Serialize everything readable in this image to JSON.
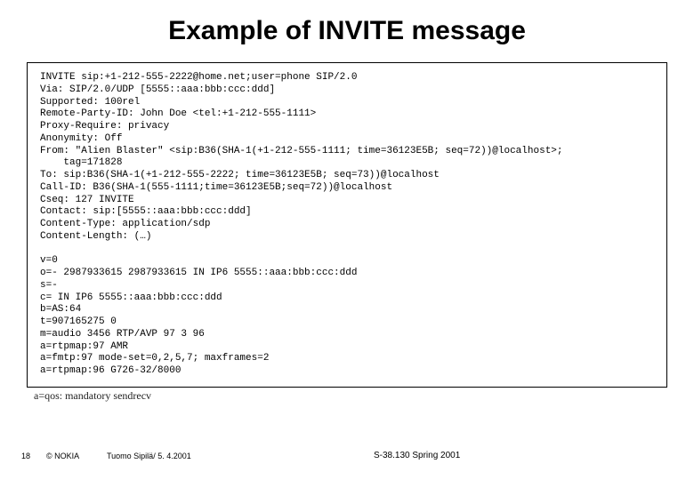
{
  "title": "Example of INVITE message",
  "code_lines": [
    "INVITE sip:+1-212-555-2222@home.net;user=phone SIP/2.0",
    "Via: SIP/2.0/UDP [5555::aaa:bbb:ccc:ddd]",
    "Supported: 100rel",
    "Remote-Party-ID: John Doe <tel:+1-212-555-1111>",
    "Proxy-Require: privacy",
    "Anonymity: Off",
    "From: \"Alien Blaster\" <sip:B36(SHA-1(+1-212-555-1111; time=36123E5B; seq=72))@localhost>;",
    "    tag=171828",
    "To: sip:B36(SHA-1(+1-212-555-2222; time=36123E5B; seq=73))@localhost",
    "Call-ID: B36(SHA-1(555-1111;time=36123E5B;seq=72))@localhost",
    "Cseq: 127 INVITE",
    "Contact: sip:[5555::aaa:bbb:ccc:ddd]",
    "Content-Type: application/sdp",
    "Content-Length: (…)",
    "",
    "v=0",
    "o=- 2987933615 2987933615 IN IP6 5555::aaa:bbb:ccc:ddd",
    "s=-",
    "c= IN IP6 5555::aaa:bbb:ccc:ddd",
    "b=AS:64",
    "t=907165275 0",
    "m=audio 3456 RTP/AVP 97 3 96",
    "a=rtpmap:97 AMR",
    "a=fmtp:97 mode-set=0,2,5,7; maxframes=2",
    "a=rtpmap:96 G726-32/8000"
  ],
  "qos_text": "a=qos: mandatory sendrecv",
  "footer": {
    "page": "18",
    "copyright": "© NOKIA",
    "author": "Tuomo Sipilä/ 5. 4.2001",
    "course": "S-38.130 Spring 2001"
  }
}
